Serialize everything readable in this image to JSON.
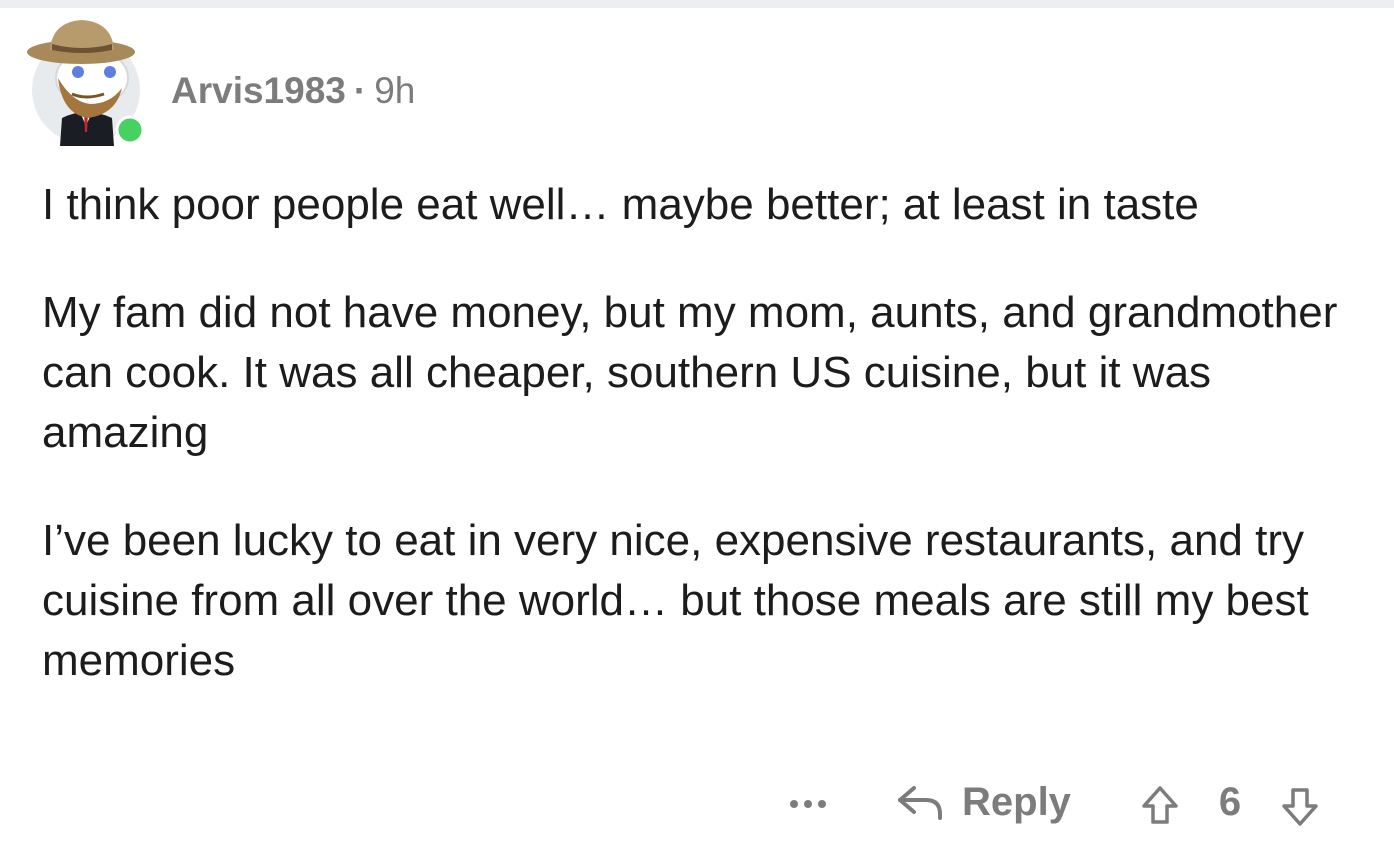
{
  "comment": {
    "username": "Arvis1983",
    "separator": "·",
    "time": "9h",
    "online": true,
    "avatar_icon": "snoo-avatar-cowboy-hat-icon",
    "paragraphs": [
      "I think poor people eat well… maybe better; at least in taste",
      "My fam did not have money, but my mom, aunts, and grandmother can cook. It was all cheaper, southern US cuisine, but it was amazing",
      "I’ve been lucky to eat in very nice, expensive restaurants, and try cuisine from all over the world… but those meals are still my best memories"
    ]
  },
  "actions": {
    "more_icon": "ellipsis-icon",
    "reply_icon": "reply-arrow-icon",
    "reply_label": "Reply",
    "upvote_icon": "upvote-arrow-icon",
    "score": "6",
    "downvote_icon": "downvote-arrow-icon"
  },
  "colors": {
    "muted_text": "#7c7c7c",
    "body_text": "#1c1c1c",
    "online_indicator": "#46d160",
    "top_strip": "#edeef1"
  }
}
